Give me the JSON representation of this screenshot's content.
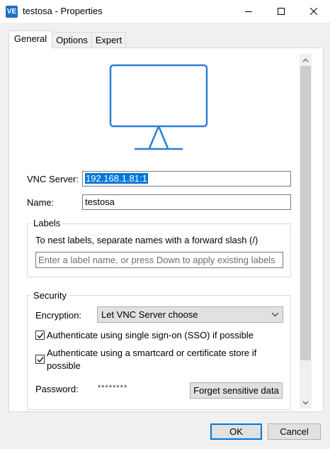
{
  "window": {
    "app_icon": "VE",
    "title": "testosa - Properties"
  },
  "tabs": [
    {
      "label": "General",
      "active": true
    },
    {
      "label": "Options",
      "active": false
    },
    {
      "label": "Expert",
      "active": false
    }
  ],
  "general": {
    "vnc_server_label": "VNC Server:",
    "vnc_server_value": "192.168.1.81:1",
    "name_label": "Name:",
    "name_value": "testosa",
    "labels_group": {
      "title": "Labels",
      "hint": "To nest labels, separate names with a forward slash (/)",
      "input_placeholder": "Enter a label name, or press Down to apply existing labels"
    },
    "security_group": {
      "title": "Security",
      "encryption_label": "Encryption:",
      "encryption_value": "Let VNC Server choose",
      "sso_label": "Authenticate using single sign-on (SSO) if possible",
      "sso_checked": true,
      "smartcard_label_line1": "Authenticate using a smartcard or certificate store if",
      "smartcard_label_line2": "possible",
      "smartcard_checked": true,
      "password_label": "Password:",
      "password_value": "********",
      "forget_button": "Forget sensitive data"
    }
  },
  "footer": {
    "ok_label": "OK",
    "cancel_label": "Cancel"
  },
  "colors": {
    "accent": "#0078d7",
    "monitor_stroke": "#2b7fd4"
  },
  "icons": {
    "app": "vnc-viewer-icon",
    "minimize": "minimize-icon",
    "maximize": "maximize-icon",
    "close": "close-icon",
    "monitor": "monitor-icon",
    "dropdown": "chevron-down-icon",
    "scroll_up": "scroll-up-icon",
    "scroll_down": "scroll-down-icon"
  }
}
